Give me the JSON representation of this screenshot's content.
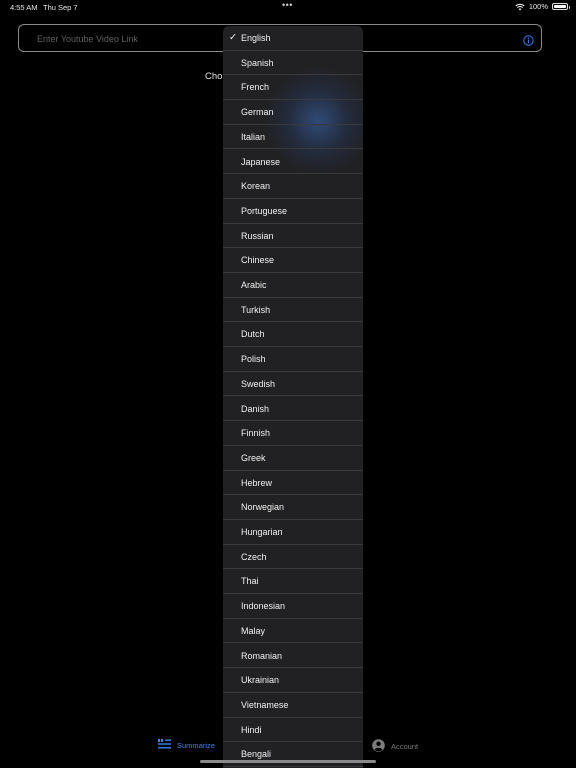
{
  "status_bar": {
    "time": "4:55 AM",
    "date": "Thu Sep 7",
    "dots": "•••",
    "battery": "100%"
  },
  "url_field": {
    "placeholder": "Enter Youtube Video Link",
    "value": ""
  },
  "choose_label": "Cho",
  "language_menu": {
    "selected": "English",
    "check_mark": "✓",
    "items": [
      "English",
      "Spanish",
      "French",
      "German",
      "Italian",
      "Japanese",
      "Korean",
      "Portuguese",
      "Russian",
      "Chinese",
      "Arabic",
      "Turkish",
      "Dutch",
      "Polish",
      "Swedish",
      "Danish",
      "Finnish",
      "Greek",
      "Hebrew",
      "Norwegian",
      "Hungarian",
      "Czech",
      "Thai",
      "Indonesian",
      "Malay",
      "Romanian",
      "Ukrainian",
      "Vietnamese",
      "Hindi",
      "Bengali"
    ]
  },
  "tab_bar": {
    "summarize_label": "Summarize",
    "account_label": "Account",
    "active_color": "#3b82f6",
    "inactive_color": "#7c7c7c"
  },
  "colors": {
    "background": "#000000",
    "menu_background": "#212123",
    "separator": "#3a3a3c",
    "accent": "#3b82f6"
  },
  "icons": {
    "info": "info-icon",
    "wifi": "wifi-icon",
    "battery": "battery-icon",
    "summarize": "summarize-icon",
    "account": "account-icon"
  }
}
